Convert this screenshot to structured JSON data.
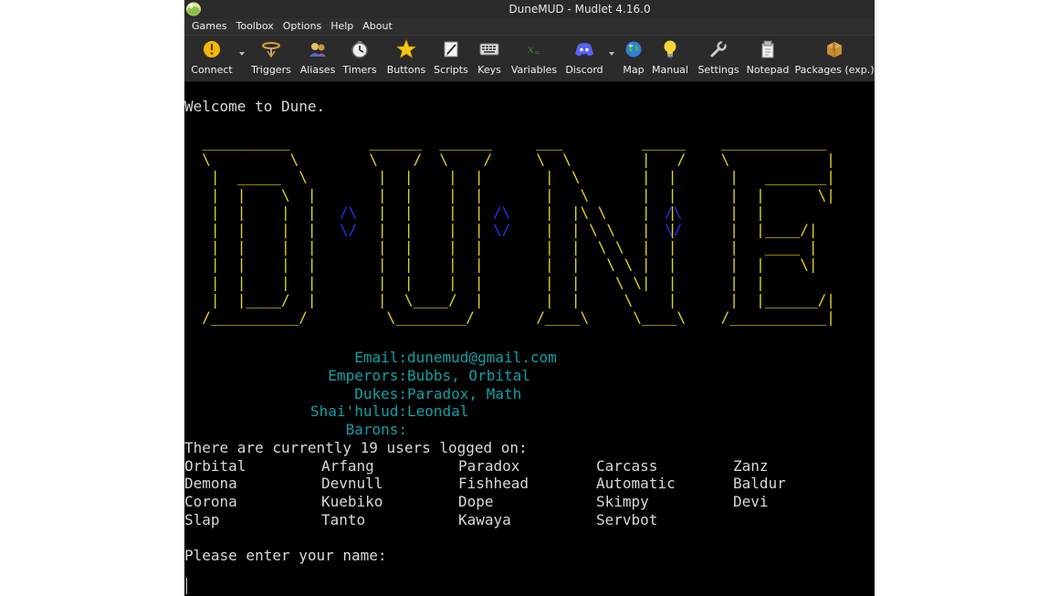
{
  "window": {
    "title": "DuneMUD - Mudlet 4.16.0"
  },
  "menu": [
    "Games",
    "Toolbox",
    "Options",
    "Help",
    "About"
  ],
  "toolbar": [
    {
      "label": "Connect",
      "icon": "connect-icon"
    },
    {
      "label": "Triggers",
      "icon": "triggers-icon"
    },
    {
      "label": "Aliases",
      "icon": "aliases-icon"
    },
    {
      "label": "Timers",
      "icon": "timers-icon"
    },
    {
      "label": "Buttons",
      "icon": "star-icon"
    },
    {
      "label": "Scripts",
      "icon": "scripts-icon"
    },
    {
      "label": "Keys",
      "icon": "keyboard-icon"
    },
    {
      "label": "Variables",
      "icon": "variables-icon"
    },
    {
      "label": "Discord",
      "icon": "discord-icon"
    },
    {
      "label": "Map",
      "icon": "globe-icon"
    },
    {
      "label": "Manual",
      "icon": "lightbulb-icon"
    },
    {
      "label": "Settings",
      "icon": "wrench-icon"
    },
    {
      "label": "Notepad",
      "icon": "notepad-icon"
    },
    {
      "label": "Packages (exp.)",
      "icon": "package-icon"
    }
  ],
  "console": {
    "welcome": "Welcome to Dune.",
    "ascii_art": [
      "  __________         ______  ______     ___         _____    ____________",
      "  \\         \\        \\    /  \\    /     \\  \\        |   /    \\           |",
      "   |  _____  \\        |  |    |  |       |  \\       |  |      |   _______|",
      "   |  |    \\  |       |  |    |  |       |   \\      |  |      |  |      \\|",
      "   |  |    |  |       |  |    |  |       |  |\\ \\    |  |      |  |",
      "   |  |    |  |       |  |    |  |       |  | \\ \\   |  |      |  |____/|",
      "   |  |    |  |       |  |    |  |       |  |  \\ \\  |  |      |   ____ |",
      "   |  |    |  |       |  |    |  |       |  |   \\ \\ |  |      |  |    \\|",
      "   |  |    |  |       |  |    |  |       |  |    \\ \\|  |      |  |",
      "   |  |____/  |       |  \\____/  |       |  |     \\    |      |  |______/|",
      "  /__________/         \\________/       /____\\     \\____\\    /___________|"
    ],
    "diamonds": [
      "/\\",
      "\\/"
    ],
    "info": [
      {
        "label": "Email:",
        "value": "dunemud@gmail.com"
      },
      {
        "label": "Emperors:",
        "value": "Bubbs, Orbital"
      },
      {
        "label": "Dukes:",
        "value": "Paradox, Math"
      },
      {
        "label": "Shai'hulud:",
        "value": "Leondal"
      },
      {
        "label": "Barons:",
        "value": ""
      }
    ],
    "users_header": "There are currently 19 users logged on:",
    "users": [
      [
        "Orbital",
        "Arfang",
        "Paradox",
        "Carcass",
        "Zanz"
      ],
      [
        "Demona",
        "Devnull",
        "Fishhead",
        "Automatic",
        "Baldur"
      ],
      [
        "Corona",
        "Kuebiko",
        "Dope",
        "Skimpy",
        "Devi"
      ],
      [
        "Slap",
        "Tanto",
        "Kawaya",
        "Servbot"
      ]
    ],
    "prompt": "Please enter your name:"
  }
}
